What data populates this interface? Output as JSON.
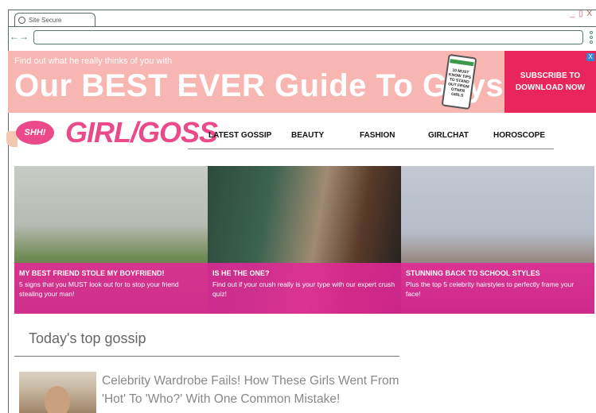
{
  "browser": {
    "tab_label": "Site Secure",
    "window_controls": "_ ▯ X",
    "nav_arrows": "←→",
    "url": ""
  },
  "ad": {
    "small_text": "Find out what he really thinks of you with",
    "headline": "Our BEST EVER Guide To Guys",
    "phone_text": "10 MUST KNOW TIPS TO STAND OUT FROM OTHER GIRLS",
    "cta": "SUBSCRIBE TO DOWNLOAD NOW",
    "close": "X"
  },
  "site": {
    "badge": "SHH!",
    "logo": "GIRL/GOSS",
    "menu": [
      "LATEST GOSSIP",
      "BEAUTY",
      "FASHION",
      "GIRLCHAT",
      "HOROSCOPE"
    ]
  },
  "hero": [
    {
      "title": "MY BEST FRIEND STOLE MY BOYFRIEND!",
      "subtitle": "5 signs that you MUST look out for to stop your friend stealing your man!"
    },
    {
      "title": "IS HE THE ONE?",
      "subtitle": "Find out if your crush really is your type with our expert crush quiz!"
    },
    {
      "title": "STUNNING BACK TO SCHOOL STYLES",
      "subtitle": "Plus the top 5 celebrity hairstyles to perfectly frame your face!"
    }
  ],
  "section": {
    "title": "Today's top gossip",
    "article": "Celebrity Wardrobe Fails! How These Girls Went From 'Hot' To 'Who?' With One Common Mistake!"
  },
  "colors": {
    "brand_pink": "#ea4a8a",
    "ad_bg": "#f8b6b3",
    "cta_bg": "#e8265c",
    "caption_bg": "#e22896"
  }
}
